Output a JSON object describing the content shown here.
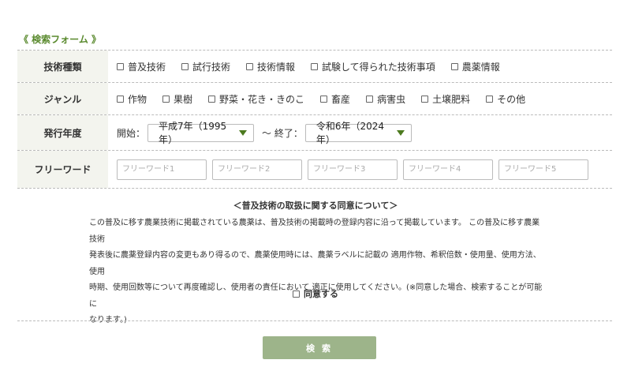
{
  "form": {
    "title": "《 検索フォーム 》"
  },
  "rows": {
    "category": {
      "label": "技術種類",
      "options": [
        "普及技術",
        "試行技術",
        "技術情報",
        "試験して得られた技術事項",
        "農薬情報"
      ]
    },
    "genre": {
      "label": "ジャンル",
      "options": [
        "作物",
        "果樹",
        "野菜・花き・きのこ",
        "畜産",
        "病害虫",
        "土壌肥料",
        "その他"
      ]
    },
    "year": {
      "label": "発行年度",
      "start_label": "開始：",
      "start_value": "平成7年（1995年）",
      "end_label": "〜 終了：",
      "end_value": "令和6年（2024年）"
    },
    "freeword": {
      "label": "フリーワード",
      "placeholders": [
        "フリーワード1",
        "フリーワード2",
        "フリーワード3",
        "フリーワード4",
        "フリーワード5"
      ]
    }
  },
  "agreement": {
    "title": "＜普及技術の取扱に関する同意について＞",
    "lines": [
      "この普及に移す農業技術に掲載されている農薬は、普及技術の掲載時の登録内容に沿って掲載しています。 この普及に移す農業技術",
      "発表後に農薬登録内容の変更もあり得るので、農薬使用時には、農薬ラベルに記載の 適用作物、希釈倍数・使用量、使用方法、使用",
      "時期、使用回数等について再度確認し、使用者の責任において 適正に使用してください。(※同意した場合、検索することが可能に",
      "なります。)"
    ],
    "checkbox_label": "同意する"
  },
  "search_button": {
    "label": "検 索"
  },
  "colors": {
    "accent": "#5a8a2e",
    "label_bg": "#f3f4ee",
    "button_bg": "#9db48a"
  }
}
